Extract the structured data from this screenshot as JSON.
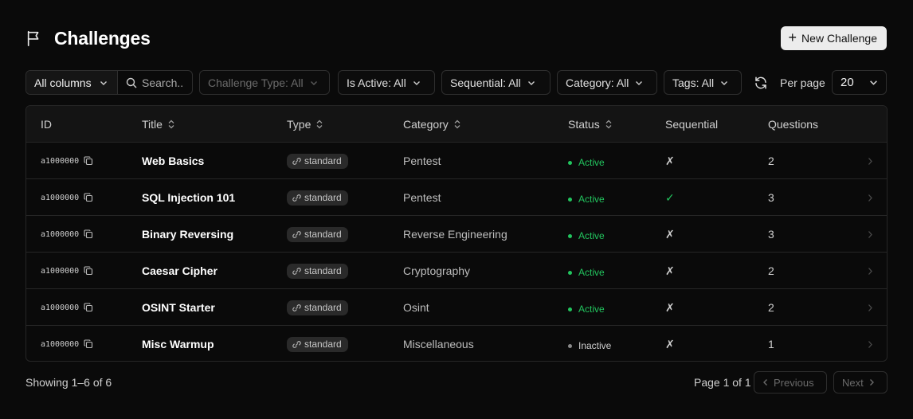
{
  "header": {
    "title": "Challenges",
    "new_button": "New Challenge"
  },
  "filters": {
    "columns_select": "All columns",
    "search_placeholder": "Search..",
    "challenge_type": "Challenge Type: All",
    "is_active": "Is Active: All",
    "sequential": "Sequential: All",
    "category": "Category: All",
    "tags": "Tags: All",
    "per_page_label": "Per page",
    "per_page_value": "20"
  },
  "table": {
    "columns": [
      "ID",
      "Title",
      "Type",
      "Category",
      "Status",
      "Sequential",
      "Questions"
    ],
    "rows": [
      {
        "id": "a1000000",
        "title": "Web Basics",
        "type": "standard",
        "category": "Pentest",
        "status": "Active",
        "sequential": "✗",
        "questions": "2"
      },
      {
        "id": "a1000000",
        "title": "SQL Injection 101",
        "type": "standard",
        "category": "Pentest",
        "status": "Active",
        "sequential": "✓",
        "questions": "3"
      },
      {
        "id": "a1000000",
        "title": "Binary Reversing",
        "type": "standard",
        "category": "Reverse Engineering",
        "status": "Active",
        "sequential": "✗",
        "questions": "3"
      },
      {
        "id": "a1000000",
        "title": "Caesar Cipher",
        "type": "standard",
        "category": "Cryptography",
        "status": "Active",
        "sequential": "✗",
        "questions": "2"
      },
      {
        "id": "a1000000",
        "title": "OSINT Starter",
        "type": "standard",
        "category": "Osint",
        "status": "Active",
        "sequential": "✗",
        "questions": "2"
      },
      {
        "id": "a1000000",
        "title": "Misc Warmup",
        "type": "standard",
        "category": "Miscellaneous",
        "status": "Inactive",
        "sequential": "✗",
        "questions": "1"
      }
    ]
  },
  "footer": {
    "showing": "Showing 1–6 of 6",
    "page_info": "Page 1 of 1",
    "previous": "Previous",
    "next": "Next"
  },
  "colors": {
    "active": "#22c55e",
    "inactive": "#8a8a8a",
    "check": "#22c55e",
    "cross": "#cfcfcf"
  },
  "icons": {
    "header": "flag-icon",
    "new": "plus-icon",
    "search": "search-icon",
    "refresh": "refresh-icon",
    "copy": "copy-icon",
    "type": "link-icon",
    "row": "chevron-right-icon"
  }
}
